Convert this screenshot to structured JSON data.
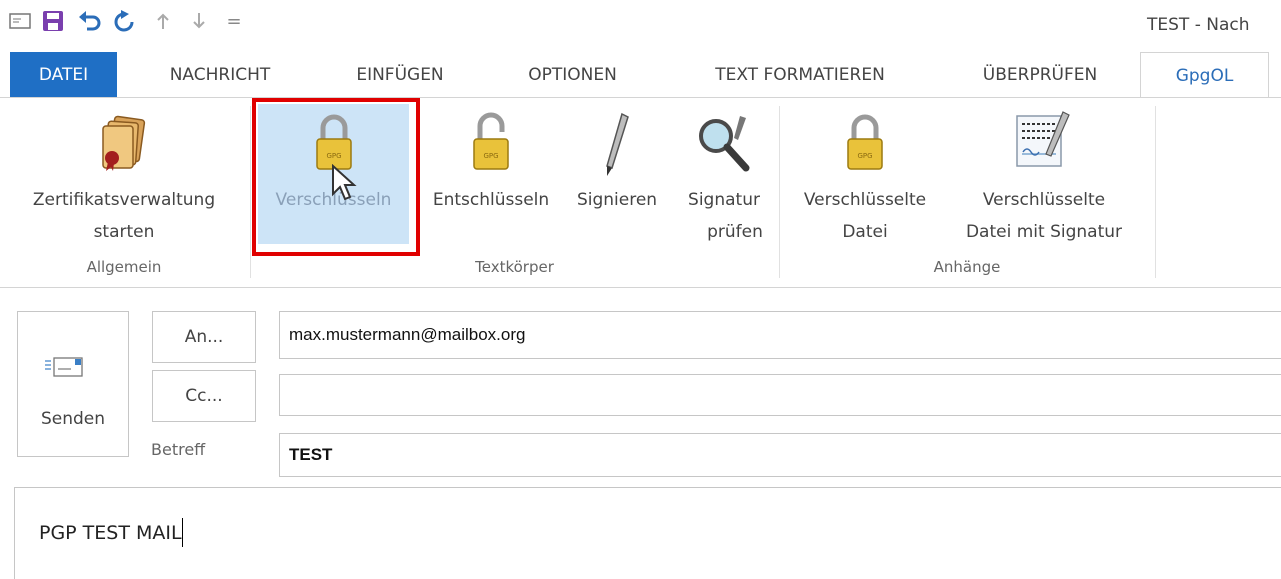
{
  "window": {
    "title": "TEST - Nach"
  },
  "quick_access": {
    "icons": [
      "mail-icon",
      "save-icon",
      "undo-icon",
      "redo-icon",
      "up-arrow-icon",
      "down-arrow-icon",
      "customize-icon"
    ],
    "customize_glyph": "="
  },
  "tabs": [
    {
      "label": "DATEI"
    },
    {
      "label": "NACHRICHT"
    },
    {
      "label": "EINFÜGEN"
    },
    {
      "label": "OPTIONEN"
    },
    {
      "label": "TEXT FORMATIEREN"
    },
    {
      "label": "ÜBERPRÜFEN"
    },
    {
      "label": "GpgOL"
    }
  ],
  "ribbon": {
    "groups": [
      {
        "label": "Allgemein"
      },
      {
        "label": "Textkörper"
      },
      {
        "label": "Anhänge"
      }
    ],
    "buttons": {
      "cert_manager": {
        "line1": "Zertifikatsverwaltung",
        "line2": "starten",
        "icon": "certificate-scroll-icon"
      },
      "encrypt": {
        "line1": "Verschlüsseln",
        "icon": "padlock-icon"
      },
      "decrypt": {
        "line1": "Entschlüsseln",
        "icon": "open-padlock-icon"
      },
      "sign": {
        "line1": "Signieren",
        "icon": "pen-icon"
      },
      "verify": {
        "line1": "Signatur",
        "line2": "prüfen",
        "icon": "magnifier-icon"
      },
      "encrypted_file": {
        "line1": "Verschlüsselte",
        "line2": "Datei",
        "icon": "padlock-icon"
      },
      "encrypted_signed_file": {
        "line1": "Verschlüsselte",
        "line2": "Datei mit Signatur",
        "icon": "signed-document-icon"
      }
    },
    "lock_label": "GPG"
  },
  "compose": {
    "send_label": "Senden",
    "to_button": "An...",
    "cc_button": "Cc...",
    "subject_label": "Betreff",
    "to_value": "max.mustermann@mailbox.org",
    "cc_value": "",
    "subject_value": "TEST",
    "body_text": "PGP TEST MAIL"
  },
  "colors": {
    "file_tab": "#1f6fc5",
    "active_tab_text": "#2b6db8",
    "highlight": "#cde4f7",
    "annotation_frame": "#e00000"
  }
}
